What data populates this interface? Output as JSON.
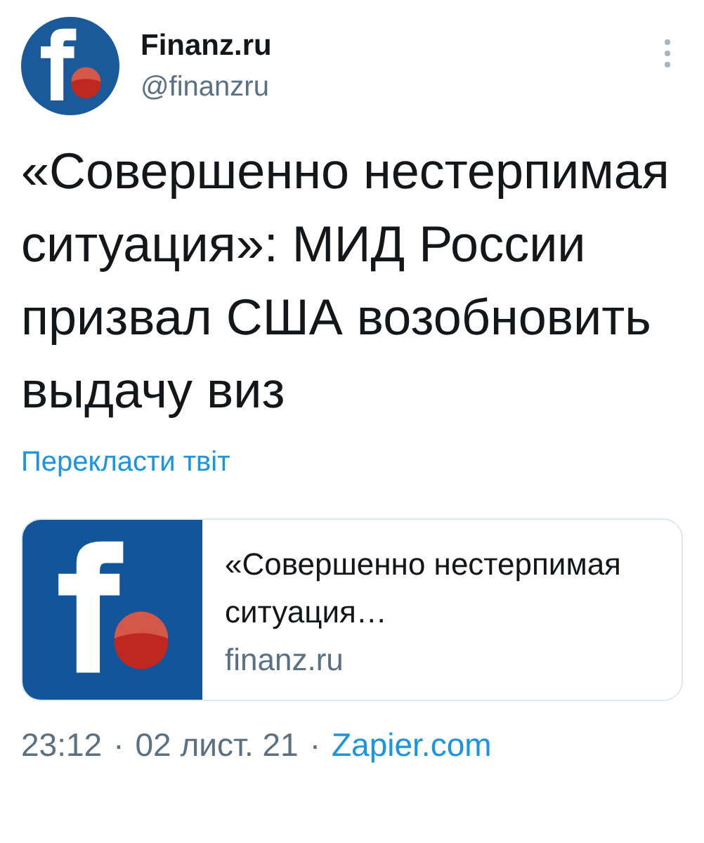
{
  "author": {
    "name": "Finanz.ru",
    "handle": "@finanzru"
  },
  "tweet": {
    "text": "«Совершенно нестерпимая ситуация»: МИД России призвал США возобновить выдачу виз",
    "translate": "Перекласти твіт"
  },
  "link_card": {
    "title": "«Совершенно нестерпимая ситуация…",
    "domain": "finanz.ru"
  },
  "meta": {
    "time": "23:12",
    "date": "02 лист. 21",
    "source": "Zapier.com",
    "separator": "·"
  }
}
